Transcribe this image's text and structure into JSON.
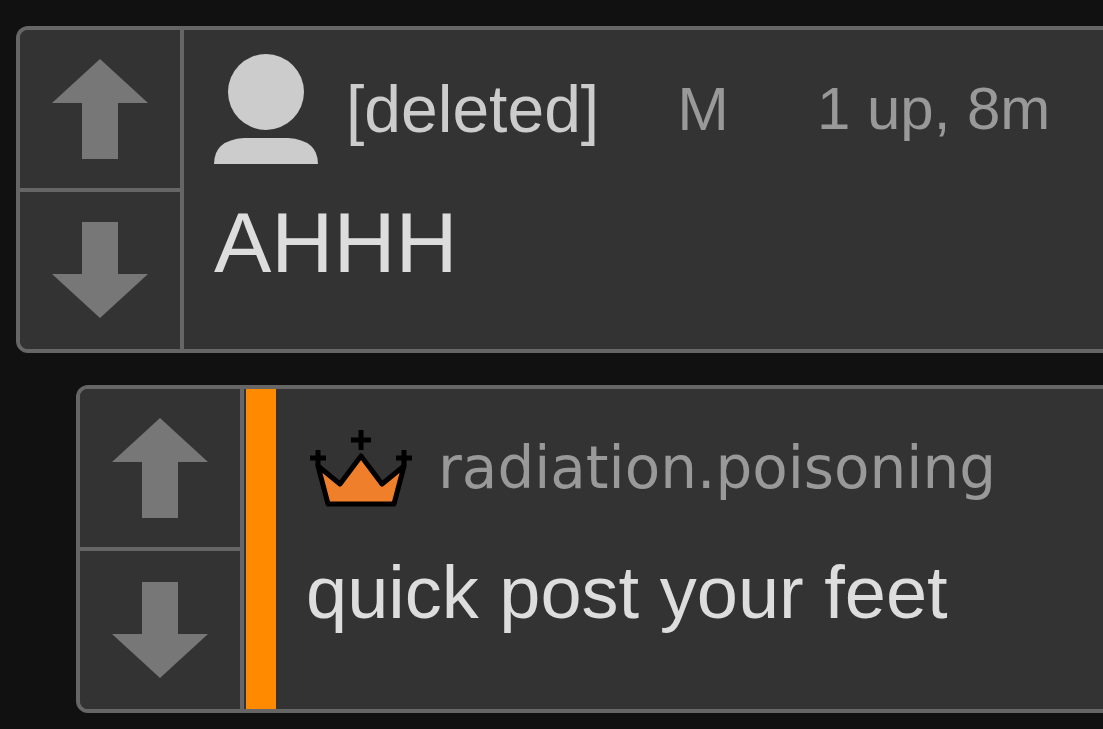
{
  "comments": [
    {
      "kind": "person",
      "author": "[deleted]",
      "flag": "M",
      "meta": "1 up, 8m",
      "body": "AHHH",
      "highlighted": false,
      "replies": [
        {
          "kind": "crown",
          "author": "radiation.poisoning",
          "body": "quick post your feet",
          "highlighted": true
        }
      ]
    }
  ]
}
